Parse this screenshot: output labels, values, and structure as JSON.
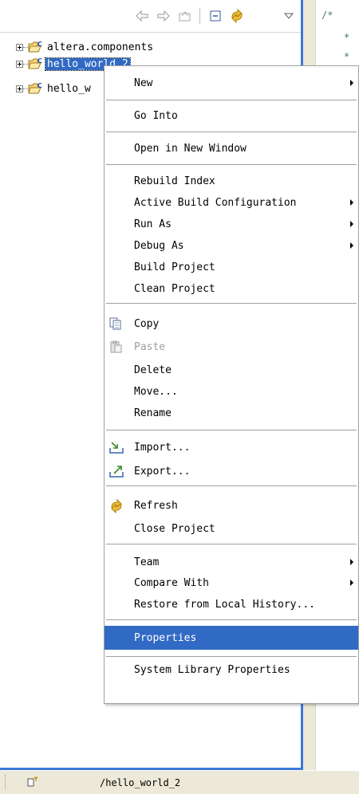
{
  "explorer": {
    "items": [
      {
        "label": "altera.components"
      },
      {
        "label": "hello_world_2"
      },
      {
        "label": "hello_w"
      }
    ]
  },
  "editor": {
    "lines": [
      "/*",
      "*",
      "*"
    ]
  },
  "context_menu": {
    "items": [
      {
        "label": "New",
        "submenu": true
      },
      {
        "label": "Go Into"
      },
      {
        "label": "Open in New Window"
      },
      {
        "label": "Rebuild Index"
      },
      {
        "label": "Active Build Configuration",
        "submenu": true
      },
      {
        "label": "Run As",
        "submenu": true
      },
      {
        "label": "Debug As",
        "submenu": true
      },
      {
        "label": "Build Project"
      },
      {
        "label": "Clean Project"
      },
      {
        "label": "Copy",
        "icon": "copy-icon"
      },
      {
        "label": "Paste",
        "icon": "paste-icon",
        "disabled": true
      },
      {
        "label": "Delete"
      },
      {
        "label": "Move..."
      },
      {
        "label": "Rename"
      },
      {
        "label": "Import...",
        "icon": "import-icon"
      },
      {
        "label": "Export...",
        "icon": "export-icon"
      },
      {
        "label": "Refresh",
        "icon": "refresh-icon"
      },
      {
        "label": "Close Project"
      },
      {
        "label": "Team",
        "submenu": true
      },
      {
        "label": "Compare With",
        "submenu": true
      },
      {
        "label": "Restore from Local History..."
      },
      {
        "label": "Properties",
        "highlighted": true
      },
      {
        "label": "System Library Properties"
      }
    ]
  },
  "statusbar": {
    "path": "/hello_world_2"
  },
  "colors": {
    "selection": "#316ac5",
    "border_blue": "#3c78d8",
    "menu_background": "#ffffff"
  }
}
